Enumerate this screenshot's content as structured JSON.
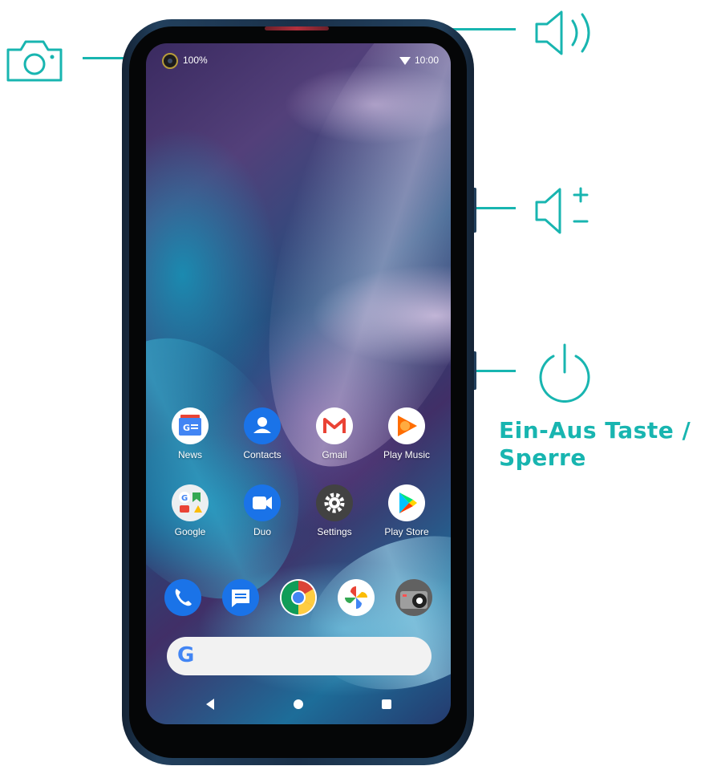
{
  "callouts": {
    "camera": "camera-icon",
    "speaker": "speaker-icon",
    "volume": "volume-icon",
    "power": "power-icon",
    "power_label": "Ein-Aus Taste / Sperre",
    "accent_color": "#18b5b0"
  },
  "status_bar": {
    "battery": "100%",
    "time": "10:00"
  },
  "home_apps": [
    {
      "label": "News",
      "icon": "news-icon"
    },
    {
      "label": "Contacts",
      "icon": "contacts-icon"
    },
    {
      "label": "Gmail",
      "icon": "gmail-icon"
    },
    {
      "label": "Play Music",
      "icon": "play-music-icon"
    },
    {
      "label": "Google",
      "icon": "google-folder-icon"
    },
    {
      "label": "Duo",
      "icon": "duo-icon"
    },
    {
      "label": "Settings",
      "icon": "settings-icon"
    },
    {
      "label": "Play Store",
      "icon": "play-store-icon"
    }
  ],
  "dock": [
    {
      "icon": "phone-icon"
    },
    {
      "icon": "messages-icon"
    },
    {
      "icon": "chrome-icon"
    },
    {
      "icon": "photos-icon"
    },
    {
      "icon": "camera-app-icon"
    }
  ],
  "search_bar": {
    "logo": "G"
  },
  "nav_bar": [
    "back",
    "home",
    "recents"
  ]
}
